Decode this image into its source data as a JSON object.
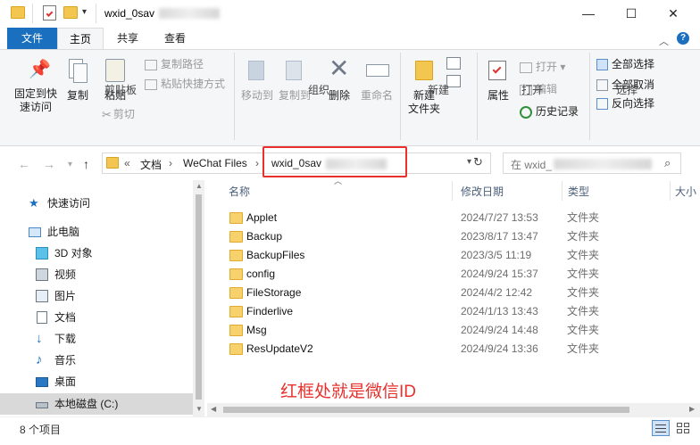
{
  "window": {
    "title": "wxid_0sav",
    "minimize": "—",
    "maximize": "☐",
    "close": "✕"
  },
  "ribbon_tabs": [
    "文件",
    "主页",
    "共享",
    "查看"
  ],
  "ribbon": {
    "pin_label": "固定到快\n速访问",
    "copy_label": "复制",
    "paste_label": "粘贴",
    "copy_path": "复制路径",
    "paste_shortcut": "粘贴快捷方式",
    "cut": "剪切",
    "clipboard_group": "剪贴板",
    "move_to": "移动到",
    "copy_to": "复制到",
    "delete": "删除",
    "rename": "重命名",
    "organize_group": "组织",
    "new_folder": "新建\n文件夹",
    "new_group": "新建",
    "properties": "属性",
    "open": "打开",
    "edit": "编辑",
    "history": "历史记录",
    "open_group": "打开",
    "select_all": "全部选择",
    "select_none": "全部取消",
    "invert": "反向选择",
    "select_group": "选择"
  },
  "address": {
    "crumbs": [
      "文档",
      "WeChat Files",
      "wxid_0sav"
    ],
    "prefix": "«",
    "search_placeholder": "在 wxid_"
  },
  "nav": {
    "quick_access": "快速访问",
    "this_pc": "此电脑",
    "items": [
      "3D 对象",
      "视频",
      "图片",
      "文档",
      "下载",
      "音乐",
      "桌面",
      "本地磁盘 (C:)"
    ]
  },
  "columns": {
    "name": "名称",
    "modified": "修改日期",
    "type": "类型",
    "size": "大小"
  },
  "files": [
    {
      "name": "Applet",
      "date": "2024/7/27 13:53",
      "type": "文件夹"
    },
    {
      "name": "Backup",
      "date": "2023/8/17 13:47",
      "type": "文件夹"
    },
    {
      "name": "BackupFiles",
      "date": "2023/3/5 11:19",
      "type": "文件夹"
    },
    {
      "name": "config",
      "date": "2024/9/24 15:37",
      "type": "文件夹"
    },
    {
      "name": "FileStorage",
      "date": "2024/4/2 12:42",
      "type": "文件夹"
    },
    {
      "name": "Finderlive",
      "date": "2024/1/13 13:43",
      "type": "文件夹"
    },
    {
      "name": "Msg",
      "date": "2024/9/24 14:48",
      "type": "文件夹"
    },
    {
      "name": "ResUpdateV2",
      "date": "2024/9/24 13:36",
      "type": "文件夹"
    }
  ],
  "annotation": "红框处就是微信ID",
  "status": {
    "count": "8 个项目"
  },
  "colors": {
    "accent": "#1a6fbf",
    "highlight": "#e8302c"
  }
}
